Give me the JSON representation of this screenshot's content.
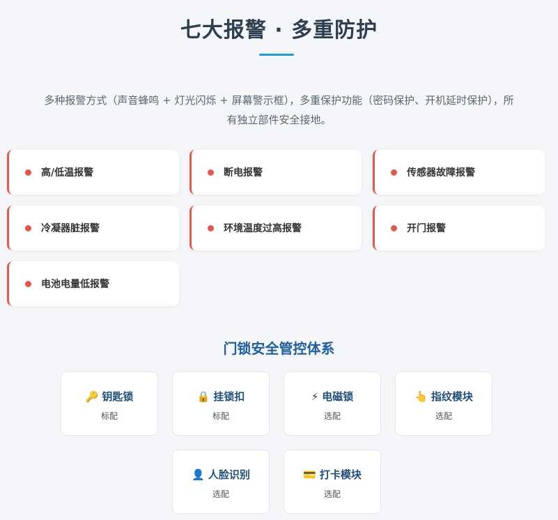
{
  "header": {
    "title": "七大报警 · 多重防护",
    "description": "多种报警方式（声音蜂鸣 + 灯光闪烁 + 屏幕警示框），多重保护功能（密码保护、开机延时保护），所有独立部件安全接地。"
  },
  "alarms": [
    {
      "label": "高/低温报警"
    },
    {
      "label": "断电报警"
    },
    {
      "label": "传感器故障报警"
    },
    {
      "label": "冷凝器脏报警"
    },
    {
      "label": "环境温度过高报警"
    },
    {
      "label": "开门报警"
    },
    {
      "label": "电池电量低报警"
    }
  ],
  "lock_section": {
    "title": "门锁安全管控体系",
    "items": [
      {
        "icon": "key-icon",
        "glyph": "🔑",
        "name": "钥匙锁",
        "tag": "标配"
      },
      {
        "icon": "padlock-icon",
        "glyph": "🔒",
        "name": "挂锁扣",
        "tag": "标配"
      },
      {
        "icon": "lightning-icon",
        "glyph": "⚡",
        "name": "电磁锁",
        "tag": "选配"
      },
      {
        "icon": "pointing-hand-icon",
        "glyph": "👆",
        "name": "指纹模块",
        "tag": "选配"
      },
      {
        "icon": "person-icon",
        "glyph": "👤",
        "name": "人脸识别",
        "tag": "选配"
      },
      {
        "icon": "card-icon",
        "glyph": "💳",
        "name": "打卡模块",
        "tag": "选配"
      }
    ]
  },
  "colors": {
    "accent_blue": "#1a9bd7",
    "alarm_red": "#e05a4b",
    "section_blue": "#1f5fa0"
  }
}
